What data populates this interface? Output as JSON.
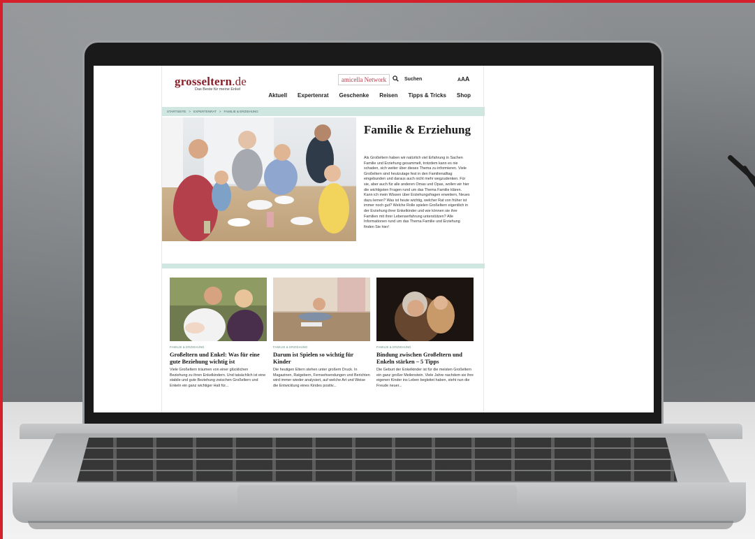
{
  "site": {
    "logo_main": "grosseltern",
    "logo_tld": ".de",
    "tagline": "Das Beste für meine Enkel",
    "network": "amicella Network",
    "search_label": "Suchen",
    "font_size_controls": [
      "A",
      "A",
      "A"
    ]
  },
  "nav": {
    "items": [
      "Aktuell",
      "Expertenrat",
      "Geschenke",
      "Reisen",
      "Tipps & Tricks",
      "Shop"
    ]
  },
  "breadcrumb": {
    "items": [
      "STARTSEITE",
      ">",
      "EXPERTENRAT",
      ">",
      "FAMILIE & ERZIEHUNG"
    ]
  },
  "hero": {
    "title": "Familie & Erziehung",
    "text": "Als Großeltern haben wir natürlich viel Erfahrung in Sachen Familie und Erziehung gesammelt, trotzdem kann es nie schaden, sich weiter über dieses Thema zu informieren. Viele Großeltern sind heutzutage fest in den Familienalltag eingebunden und daraus auch nicht mehr wegzudenken. Für sie, aber auch für alle anderen Omas und Opas, wollen wir hier die wichtigsten Fragen rund um das Thema Familie klären. Kann ich mein Wissen über Erziehungsfragen erweitern, Neues dazu lernen? Was ist heute wichtig, welcher Rat von früher ist immer noch gut? Welche Rolle spielen Großeltern eigentlich in der Erziehung ihrer Enkelkinder und wie können sie ihre Familien mit ihrer Lebenserfahrung unterstützen? Alle Informationen rund um das Thema Familie und Erziehung finden Sie hier!"
  },
  "articles": [
    {
      "category": "FAMILIE & ERZIEHUNG",
      "title": "Großeltern und Enkel: Was für eine gute Beziehung wichtig ist",
      "excerpt": "Viele Großeltern träumen von einer glücklichen Beziehung zu ihren Enkelkindern. Und tatsächlich ist eine stabile und gute Beziehung zwischen Großeltern und Enkeln ein ganz wichtiger Halt für..."
    },
    {
      "category": "FAMILIE & ERZIEHUNG",
      "title": "Darum ist Spielen so wichtig für Kinder",
      "excerpt": "Die heutigen Eltern stehen unter großem Druck. In Magazinen, Ratgebern, Fernsehsendungen und Berichten wird immer wieder analysiert, auf welche Art und Weise die Entwicklung eines Kindes positiv..."
    },
    {
      "category": "FAMILIE & ERZIEHUNG",
      "title": "Bindung zwischen Großeltern und Enkeln stärken – 5 Tipps",
      "excerpt": "Die Geburt der Enkelkinder ist für die meisten Großeltern ein ganz großer Meilenstein. Viele Jahre nachdem sie ihre eigenen Kinder ins Leben begleitet haben, steht nun die Freude neuer..."
    }
  ],
  "colors": {
    "brand": "#8a1f2a",
    "accent_band": "#cfe6e1",
    "photo_border": "#d4202a"
  }
}
